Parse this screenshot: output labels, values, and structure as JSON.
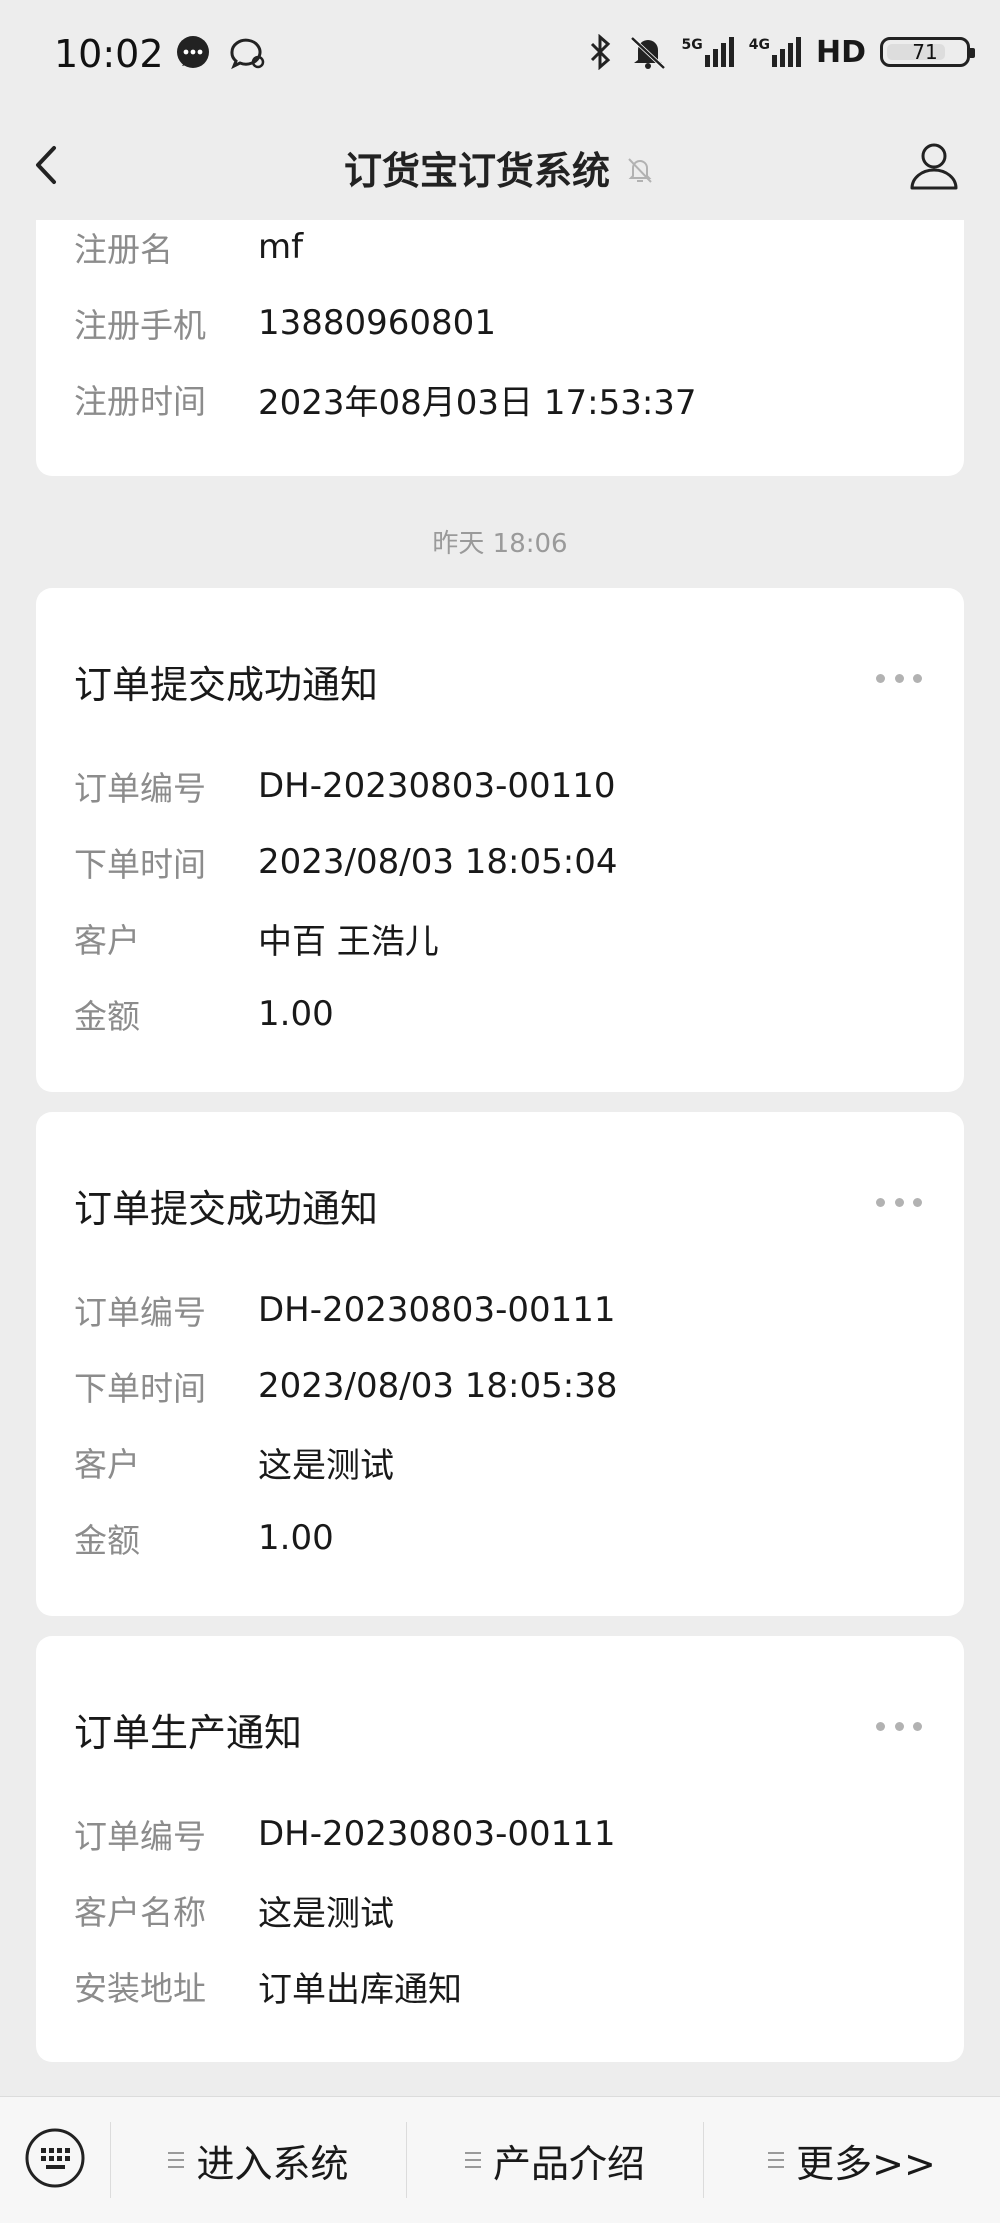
{
  "status_bar": {
    "time": "10:02",
    "battery": "71",
    "signal_labels": [
      "5G",
      "4G",
      "HD"
    ]
  },
  "nav": {
    "title": "订货宝订货系统"
  },
  "registration_card": {
    "rows": [
      {
        "label": "注册名",
        "value": "mf"
      },
      {
        "label": "注册手机",
        "value": "13880960801"
      },
      {
        "label": "注册时间",
        "value": "2023年08月03日 17:53:37"
      }
    ]
  },
  "timestamp": "昨天 18:06",
  "cards": [
    {
      "title": "订单提交成功通知",
      "rows": [
        {
          "label": "订单编号",
          "value": "DH-20230803-00110"
        },
        {
          "label": "下单时间",
          "value": "2023/08/03 18:05:04"
        },
        {
          "label": "客户",
          "value": "中百 王浩儿"
        },
        {
          "label": "金额",
          "value": "1.00"
        }
      ]
    },
    {
      "title": "订单提交成功通知",
      "rows": [
        {
          "label": "订单编号",
          "value": "DH-20230803-00111"
        },
        {
          "label": "下单时间",
          "value": "2023/08/03 18:05:38"
        },
        {
          "label": "客户",
          "value": "这是测试"
        },
        {
          "label": "金额",
          "value": "1.00"
        }
      ]
    },
    {
      "title": "订单生产通知",
      "rows": [
        {
          "label": "订单编号",
          "value": "DH-20230803-00111"
        },
        {
          "label": "客户名称",
          "value": "这是测试"
        },
        {
          "label": "安装地址",
          "value": "订单出库通知"
        }
      ]
    }
  ],
  "bottom_menu": {
    "items": [
      {
        "label": "进入系统"
      },
      {
        "label": "产品介绍"
      },
      {
        "label": "更多>>"
      }
    ]
  },
  "colors": {
    "background": "#ededed",
    "card": "#ffffff",
    "label_gray": "#8c8c8c",
    "text": "#191919"
  }
}
